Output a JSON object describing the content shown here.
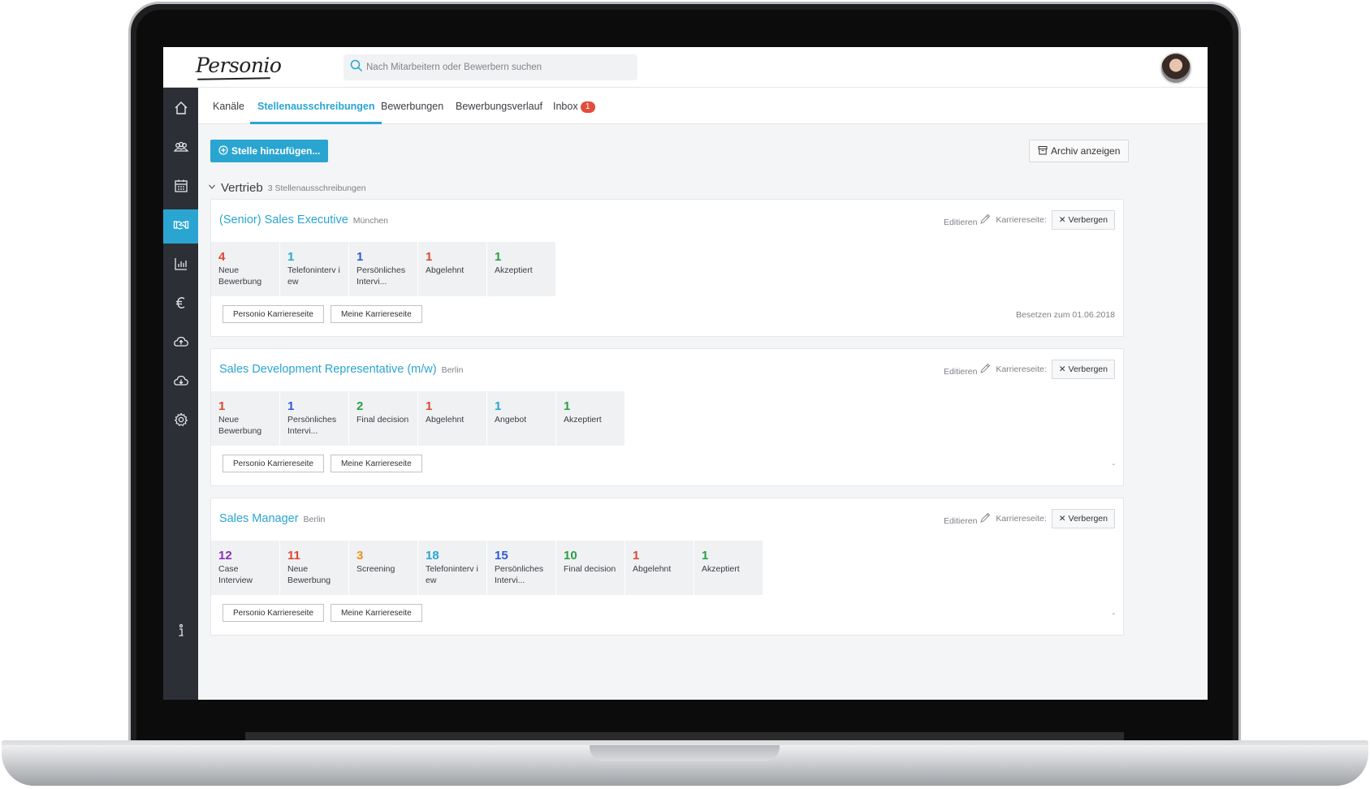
{
  "app": {
    "logo": "Personio",
    "search_placeholder": "Nach Mitarbeitern oder Bewerbern suchen"
  },
  "sidebar": {
    "items": [
      {
        "icon": "home-icon"
      },
      {
        "icon": "people-icon"
      },
      {
        "icon": "calendar-icon"
      },
      {
        "icon": "handshake-icon",
        "active": true
      },
      {
        "icon": "chart-icon"
      },
      {
        "icon": "euro-icon"
      },
      {
        "icon": "cloud-upload-icon"
      },
      {
        "icon": "cloud-download-icon"
      },
      {
        "icon": "gear-icon"
      },
      {
        "icon": "info-icon"
      }
    ]
  },
  "tabs": {
    "kanaele": "Kanäle",
    "stellen": "Stellenausschreibungen",
    "bewerbungen": "Bewerbungen",
    "verlauf": "Bewerbungsverlauf",
    "inbox": "Inbox",
    "inbox_badge": "1"
  },
  "toolbar": {
    "add_label": "Stelle hinzufügen...",
    "archive_label": "Archiv anzeigen"
  },
  "group": {
    "title": "Vertrieb",
    "count": "3 Stellenausschreibungen"
  },
  "common": {
    "edit": "Editieren",
    "career_label": "Karriereseite:",
    "hide": "Verbergen",
    "btn_personio": "Personio Karriereseite",
    "btn_mine": "Meine Karriereseite"
  },
  "jobs": [
    {
      "title": "(Senior) Sales Executive",
      "location": "München",
      "fill_date": "Besetzen zum 01.06.2018",
      "stages": [
        {
          "count": "4",
          "label": "Neue Bewerbung",
          "color": "#e0482f"
        },
        {
          "count": "1",
          "label": "Telefoninterview",
          "color": "#2aa5d2"
        },
        {
          "count": "1",
          "label": "Persönliches Intervi...",
          "color": "#2d5ad8"
        },
        {
          "count": "1",
          "label": "Abgelehnt",
          "color": "#e0482f"
        },
        {
          "count": "1",
          "label": "Akzeptiert",
          "color": "#2a9f45"
        }
      ]
    },
    {
      "title": "Sales Development Representative (m/w)",
      "location": "Berlin",
      "fill_date": "-",
      "stages": [
        {
          "count": "1",
          "label": "Neue Bewerbung",
          "color": "#e0482f"
        },
        {
          "count": "1",
          "label": "Persönliches Intervi...",
          "color": "#2d5ad8"
        },
        {
          "count": "2",
          "label": "Final decision",
          "color": "#2a9f45"
        },
        {
          "count": "1",
          "label": "Abgelehnt",
          "color": "#e0482f"
        },
        {
          "count": "1",
          "label": "Angebot",
          "color": "#2aa5d2"
        },
        {
          "count": "1",
          "label": "Akzeptiert",
          "color": "#2a9f45"
        }
      ]
    },
    {
      "title": "Sales Manager",
      "location": "Berlin",
      "fill_date": "-",
      "stages": [
        {
          "count": "12",
          "label": "Case Interview",
          "color": "#8e2fb5"
        },
        {
          "count": "11",
          "label": "Neue Bewerbung",
          "color": "#e0482f"
        },
        {
          "count": "3",
          "label": "Screening",
          "color": "#f0901e"
        },
        {
          "count": "18",
          "label": "Telefoninterview",
          "color": "#2aa5d2"
        },
        {
          "count": "15",
          "label": "Persönliches Intervi...",
          "color": "#2d5ad8"
        },
        {
          "count": "10",
          "label": "Final decision",
          "color": "#2a9f45"
        },
        {
          "count": "1",
          "label": "Abgelehnt",
          "color": "#e0482f"
        },
        {
          "count": "1",
          "label": "Akzeptiert",
          "color": "#2a9f45"
        }
      ]
    }
  ]
}
